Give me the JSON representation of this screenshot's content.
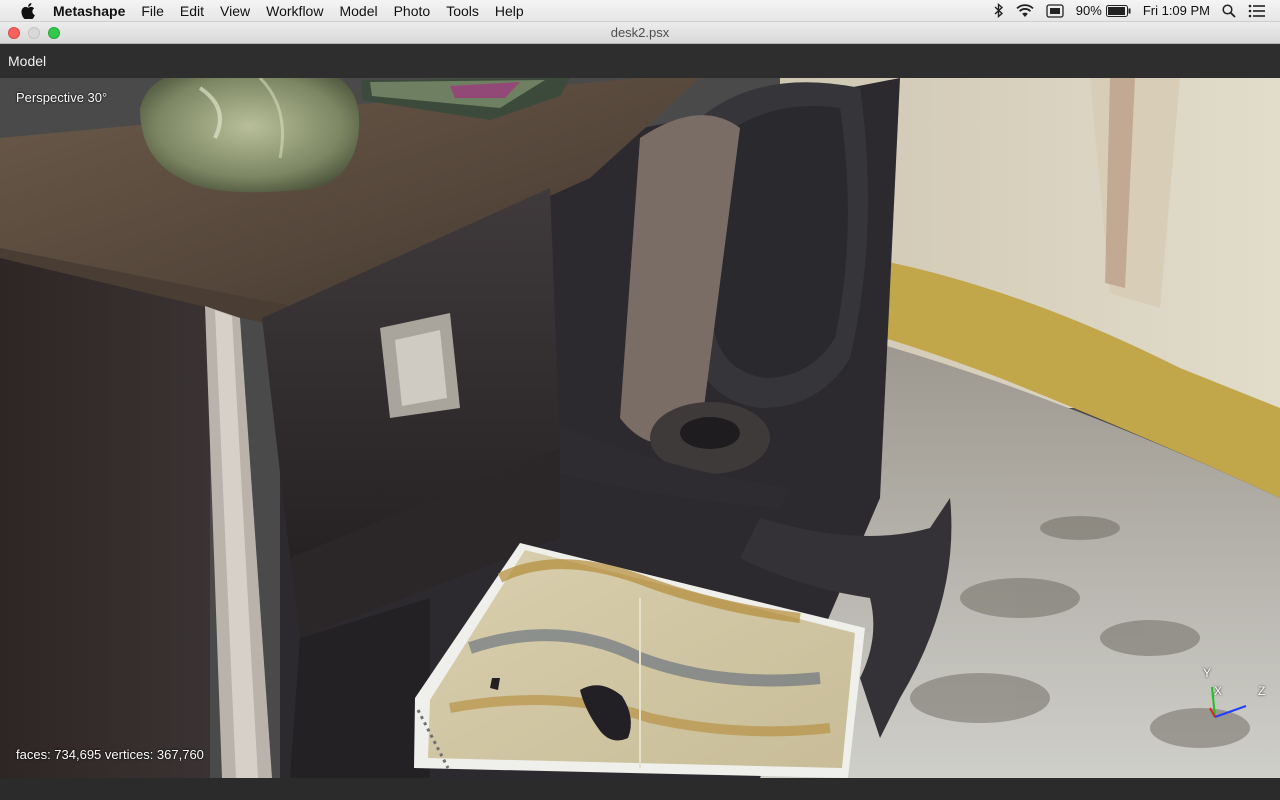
{
  "menubar": {
    "app_name": "Metashape",
    "items": [
      "File",
      "Edit",
      "View",
      "Workflow",
      "Model",
      "Photo",
      "Tools",
      "Help"
    ],
    "battery_percent": "90%",
    "clock": "Fri 1:09 PM",
    "status_icons": [
      "bluetooth-icon",
      "wifi-icon",
      "display-icon",
      "battery-icon",
      "spotlight-icon",
      "notification-center-icon"
    ]
  },
  "window": {
    "title": "desk2.psx"
  },
  "panel": {
    "title": "Model"
  },
  "viewport": {
    "projection": "Perspective 30°",
    "stats": "faces: 734,695 vertices: 367,760",
    "axes": {
      "x": "X",
      "y": "Y",
      "z": "Z"
    },
    "axis_colors": {
      "x": "#e02020",
      "y": "#20c020",
      "z": "#2040ff"
    }
  }
}
